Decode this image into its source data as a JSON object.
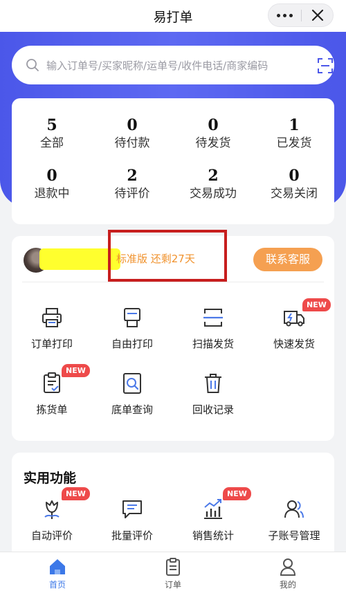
{
  "titlebar": {
    "title": "易打单"
  },
  "search": {
    "placeholder": "输入订单号/买家昵称/运单号/收件电话/商家编码"
  },
  "stats": [
    {
      "num": "5",
      "label": "全部"
    },
    {
      "num": "0",
      "label": "待付款"
    },
    {
      "num": "0",
      "label": "待发货"
    },
    {
      "num": "1",
      "label": "已发货"
    },
    {
      "num": "0",
      "label": "退款中"
    },
    {
      "num": "2",
      "label": "待评价"
    },
    {
      "num": "2",
      "label": "交易成功"
    },
    {
      "num": "0",
      "label": "交易关闭"
    }
  ],
  "account": {
    "plan": "标准版  还剩27天",
    "contact_label": "联系客服"
  },
  "badge": "NEW",
  "tools": [
    {
      "label": "订单打印",
      "icon": "printer-icon"
    },
    {
      "label": "自由打印",
      "icon": "free-print-icon"
    },
    {
      "label": "扫描发货",
      "icon": "scan-icon"
    },
    {
      "label": "快速发货",
      "icon": "truck-icon",
      "new": true
    },
    {
      "label": "拣货单",
      "icon": "clipboard-icon",
      "new": true
    },
    {
      "label": "底单查询",
      "icon": "search-doc-icon"
    },
    {
      "label": "回收记录",
      "icon": "trash-icon"
    }
  ],
  "practical": {
    "title": "实用功能",
    "items": [
      {
        "label": "自动评价",
        "icon": "flower-icon",
        "new": true
      },
      {
        "label": "批量评价",
        "icon": "chat-icon"
      },
      {
        "label": "销售统计",
        "icon": "chart-icon",
        "new": true
      },
      {
        "label": "子账号管理",
        "icon": "users-icon"
      }
    ]
  },
  "tabbar": [
    {
      "label": "首页",
      "icon": "home-icon",
      "active": true
    },
    {
      "label": "订单",
      "icon": "order-icon"
    },
    {
      "label": "我的",
      "icon": "user-icon"
    }
  ],
  "colors": {
    "primary": "#4b57e9",
    "accent": "#f5a051",
    "badge": "#ee4a4a",
    "tab_active": "#3c78e8",
    "highlight_box": "#c71e1e"
  }
}
